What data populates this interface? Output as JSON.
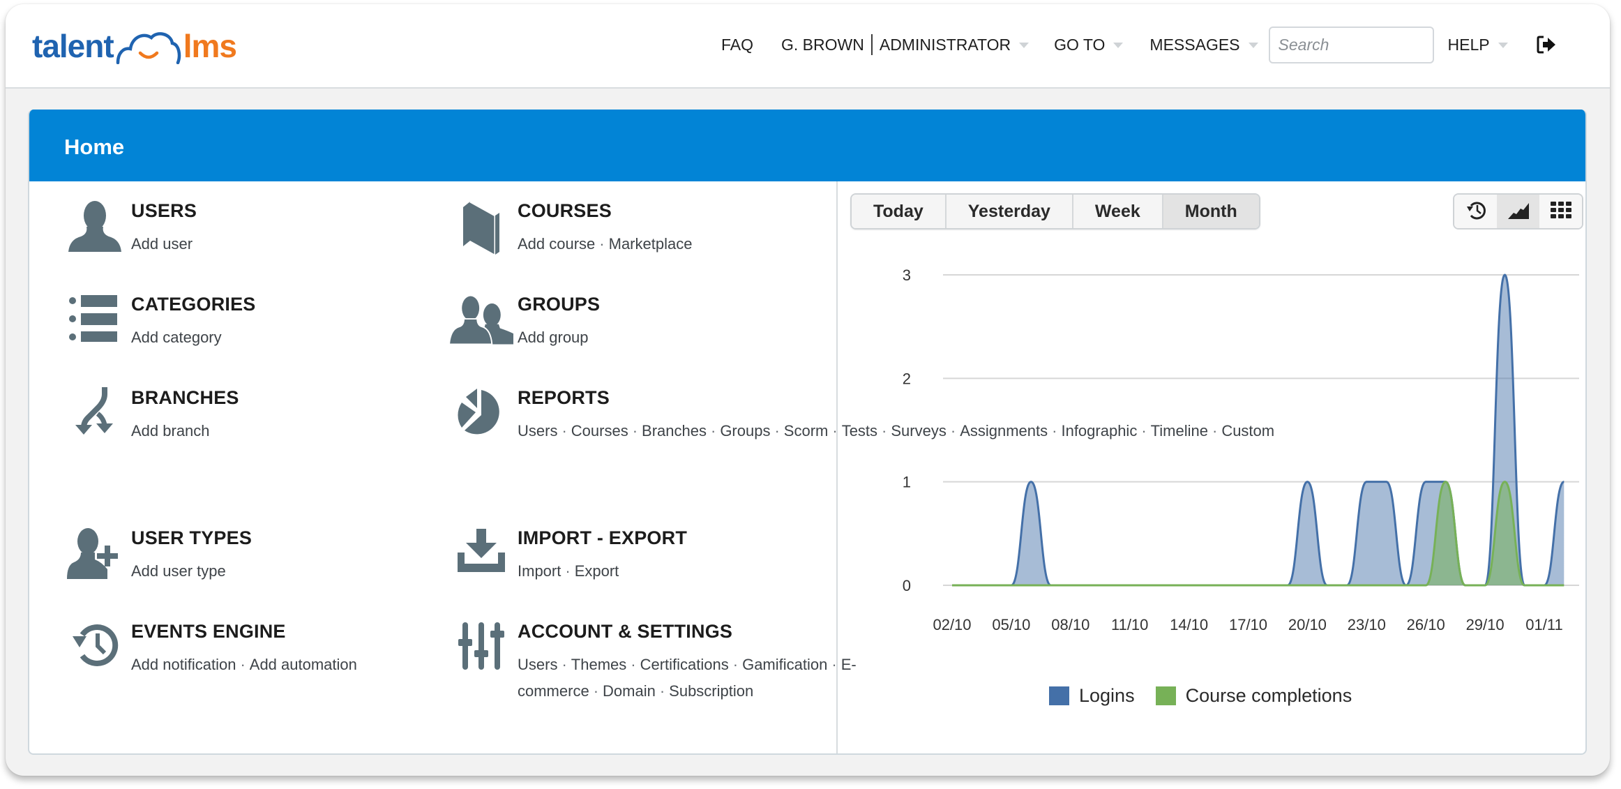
{
  "app": {
    "logo": {
      "left": "talent",
      "right": "lms",
      "icon": "cloud-smile-icon"
    },
    "colors": {
      "brand_blue": "#1f63b0",
      "brand_orange": "#f0791e",
      "header_blue": "#0284d6",
      "icon_gray": "#5b6f79",
      "logins": "#4470a8",
      "completions": "#77b157"
    }
  },
  "nav": {
    "faq": "FAQ",
    "user_name": "G. BROWN",
    "user_role": "ADMINISTRATOR",
    "goto": "GO TO",
    "messages": "MESSAGES",
    "search_placeholder": "Search",
    "search_value": "",
    "help": "HELP",
    "logout_icon": "sign-out-icon"
  },
  "page": {
    "title": "Home"
  },
  "tiles": [
    {
      "id": "users",
      "icon": "user-icon",
      "title": "USERS",
      "links": [
        "Add user"
      ]
    },
    {
      "id": "courses",
      "icon": "book-icon",
      "title": "COURSES",
      "links": [
        "Add course",
        "Marketplace"
      ]
    },
    {
      "id": "categories",
      "icon": "list-icon",
      "title": "CATEGORIES",
      "links": [
        "Add category"
      ]
    },
    {
      "id": "groups",
      "icon": "users-group-icon",
      "title": "GROUPS",
      "links": [
        "Add group"
      ]
    },
    {
      "id": "branches",
      "icon": "branch-arrows-icon",
      "title": "BRANCHES",
      "links": [
        "Add branch"
      ]
    },
    {
      "id": "reports",
      "icon": "pie-chart-icon",
      "title": "REPORTS",
      "links": [
        "Users",
        "Courses",
        "Branches",
        "Groups",
        "Scorm",
        "Tests",
        "Surveys",
        "Assignments",
        "Infographic",
        "Timeline",
        "Custom"
      ]
    },
    {
      "id": "user-types",
      "icon": "user-plus-icon",
      "title": "USER TYPES",
      "links": [
        "Add user type"
      ]
    },
    {
      "id": "import-export",
      "icon": "download-tray-icon",
      "title": "IMPORT - EXPORT",
      "links": [
        "Import",
        "Export"
      ]
    },
    {
      "id": "events-engine",
      "icon": "history-clock-icon",
      "title": "EVENTS ENGINE",
      "links": [
        "Add notification",
        "Add automation"
      ]
    },
    {
      "id": "account-settings",
      "icon": "sliders-icon",
      "title": "ACCOUNT & SETTINGS",
      "links": [
        "Users",
        "Themes",
        "Certifications",
        "Gamification",
        "E-commerce",
        "Domain",
        "Subscription"
      ]
    }
  ],
  "stats": {
    "tabs": [
      {
        "label": "Today",
        "active": false
      },
      {
        "label": "Yesterday",
        "active": false
      },
      {
        "label": "Week",
        "active": false
      },
      {
        "label": "Month",
        "active": true
      }
    ],
    "view_buttons": [
      {
        "icon": "history-icon",
        "active": false
      },
      {
        "icon": "area-chart-icon",
        "active": true
      },
      {
        "icon": "grid-icon",
        "active": false
      }
    ]
  },
  "chart_data": {
    "type": "area",
    "title": "",
    "xlabel": "",
    "ylabel": "",
    "x": [
      "02/10",
      "03/10",
      "04/10",
      "05/10",
      "06/10",
      "07/10",
      "08/10",
      "09/10",
      "10/10",
      "11/10",
      "12/10",
      "13/10",
      "14/10",
      "15/10",
      "16/10",
      "17/10",
      "18/10",
      "19/10",
      "20/10",
      "21/10",
      "22/10",
      "23/10",
      "24/10",
      "25/10",
      "26/10",
      "27/10",
      "28/10",
      "29/10",
      "30/10",
      "31/10",
      "01/11",
      "02/11"
    ],
    "x_tick_labels": [
      "02/10",
      "05/10",
      "08/10",
      "11/10",
      "14/10",
      "17/10",
      "20/10",
      "23/10",
      "26/10",
      "29/10",
      "01/11"
    ],
    "ylim": [
      0,
      3
    ],
    "y_ticks": [
      0,
      1,
      2,
      3
    ],
    "grid": true,
    "legend_position": "bottom",
    "series": [
      {
        "name": "Logins",
        "color": "#4470a8",
        "values": [
          0,
          0,
          0,
          0,
          1,
          0,
          0,
          0,
          0,
          0,
          0,
          0,
          0,
          0,
          0,
          0,
          0,
          0,
          1,
          0,
          0,
          1,
          1,
          0,
          1,
          1,
          0,
          0,
          3,
          0,
          0,
          1
        ]
      },
      {
        "name": "Course completions",
        "color": "#77b157",
        "values": [
          0,
          0,
          0,
          0,
          0,
          0,
          0,
          0,
          0,
          0,
          0,
          0,
          0,
          0,
          0,
          0,
          0,
          0,
          0,
          0,
          0,
          0,
          0,
          0,
          0,
          1,
          0,
          0,
          1,
          0,
          0,
          0
        ]
      }
    ]
  }
}
